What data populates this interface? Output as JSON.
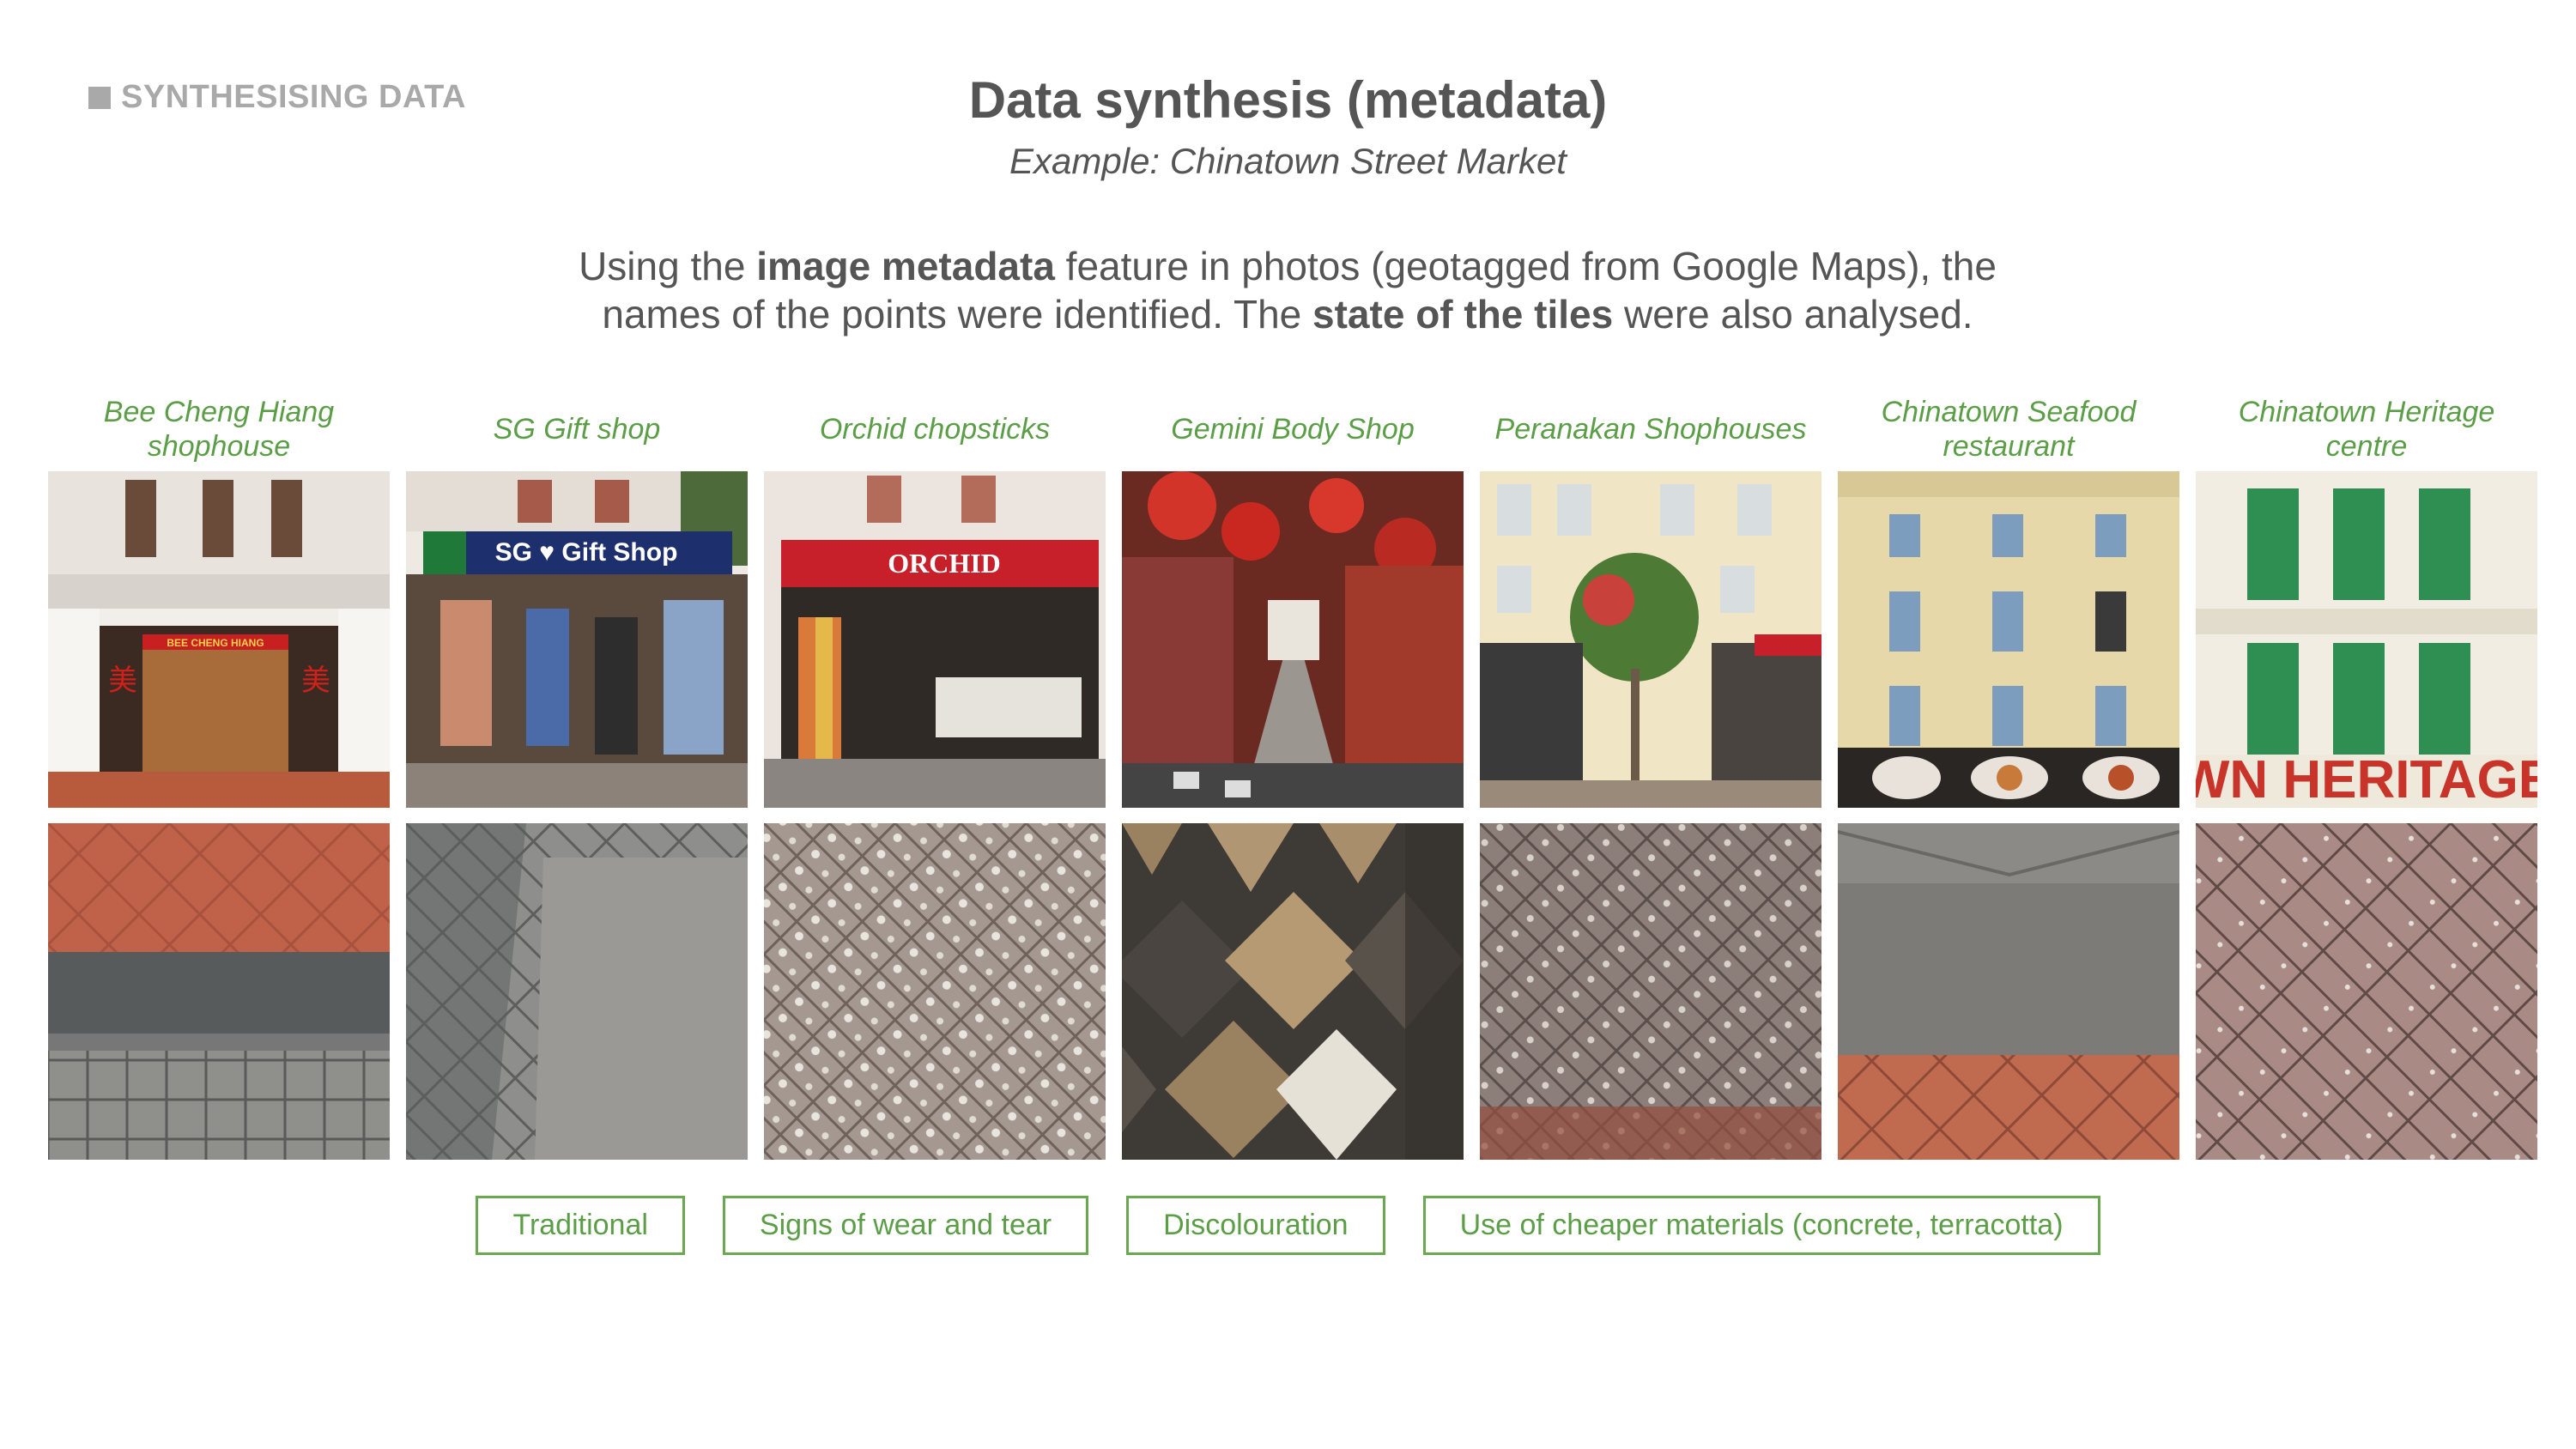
{
  "header": {
    "section_tag": "SYNTHESISING DATA",
    "title": "Data synthesis (metadata)",
    "subtitle": "Example: Chinatown Street Market"
  },
  "intro": {
    "t1": "Using the ",
    "b1": "image metadata",
    "t2": " feature in photos (geotagged from Google Maps), the names of the points were identified. The ",
    "b2": "state of the tiles",
    "t3": " were also analysed."
  },
  "locations": [
    {
      "name": "Bee Cheng Hiang shophouse",
      "sign": "BEE CHENG HIANG"
    },
    {
      "name": "SG Gift shop",
      "sign": "SG ♥ Gift Shop"
    },
    {
      "name": "Orchid chopsticks",
      "sign": "ORCHID"
    },
    {
      "name": "Gemini Body Shop",
      "sign": ""
    },
    {
      "name": "Peranakan Shophouses",
      "sign": ""
    },
    {
      "name": "Chinatown Seafood restaurant",
      "sign": ""
    },
    {
      "name": "Chinatown Heritage centre",
      "sign": "WN HERITAGE"
    }
  ],
  "tags": [
    "Traditional",
    "Signs of wear and tear",
    "Discolouration",
    "Use of cheaper materials (concrete, terracotta)"
  ],
  "colors": {
    "accent_green": "#5c9e47",
    "text_grey": "#555555",
    "tag_grey": "#a9a9a9"
  }
}
